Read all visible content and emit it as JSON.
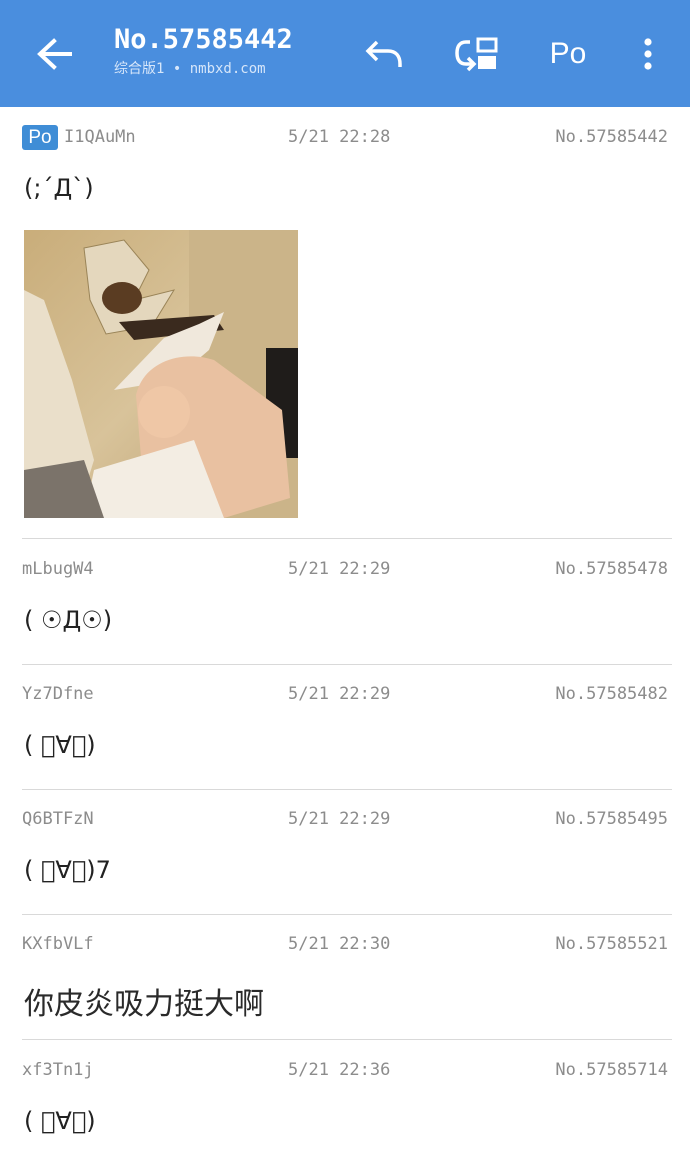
{
  "header": {
    "title": "No.57585442",
    "subtitle": "综合版1 • nmbxd.com",
    "back_icon": "arrow-left-icon",
    "reply_icon": "reply-icon",
    "refresh_icon": "refresh-icon",
    "po_label": "Po",
    "more_icon": "more-vert-icon",
    "background": "#4a8ede"
  },
  "posts": [
    {
      "po": true,
      "po_badge": "Po",
      "uid": "I1QAuMn",
      "time": "5/21 22:28",
      "no": "No.57585442",
      "content": "(;´Д`)",
      "has_image": true
    },
    {
      "po": false,
      "uid": "mLbugW4",
      "time": "5/21 22:29",
      "no": "No.57585478",
      "content": "( ☉Д☉)"
    },
    {
      "po": false,
      "uid": "Yz7Dfne",
      "time": "5/21 22:29",
      "no": "No.57585482",
      "content": "( ﾟ∀。)"
    },
    {
      "po": false,
      "uid": "Q6BTFzN",
      "time": "5/21 22:29",
      "no": "No.57585495",
      "content": "( ﾟ∀。)7"
    },
    {
      "po": false,
      "uid": "KXfbVLf",
      "time": "5/21 22:30",
      "no": "No.57585521",
      "content": "你皮炎吸力挺大啊"
    },
    {
      "po": false,
      "uid": "xf3Tn1j",
      "time": "5/21 22:36",
      "no": "No.57585714",
      "content": "( ﾟ∀。)"
    }
  ]
}
